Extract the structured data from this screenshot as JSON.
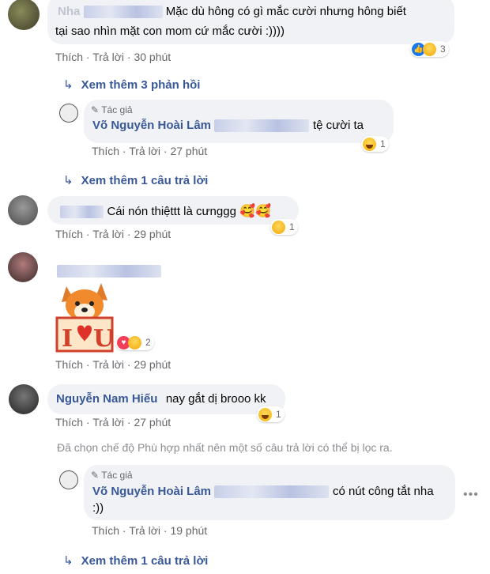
{
  "comments": [
    {
      "name_prefix": "Nha",
      "text": "Mặc dù hông có gì mắc cười nhưng hông biết tại sao nhìn mặt con mom cứ mắc cười :))))",
      "line1": "Mặc dù hông có gì mắc cười nhưng hông biết",
      "line2": "tại sao nhìn mặt con mom cứ mắc cười :))))",
      "like": "Thích",
      "reply": "Trả lời",
      "time": "30 phút",
      "reaction_count": "3",
      "more_replies": "Xem thêm 3 phản hồi"
    },
    {
      "author_label": "Tác giả",
      "name": "Võ Nguyễn Hoài Lâm",
      "text": "tệ cười ta",
      "like": "Thích",
      "reply": "Trả lời",
      "time": "27 phút",
      "reaction_count": "1",
      "more_replies": "Xem thêm 1 câu trả lời"
    },
    {
      "text": "Cái nón thiệttt là cưnggg",
      "like": "Thích",
      "reply": "Trả lời",
      "time": "29 phút",
      "reaction_count": "1"
    },
    {
      "sticker_text": "I U",
      "like": "Thích",
      "reply": "Trả lời",
      "time": "29 phút",
      "reaction_count": "2"
    },
    {
      "name": "Nguyễn Nam Hiếu",
      "text": "nay gắt dị brooo kk",
      "like": "Thích",
      "reply": "Trả lời",
      "time": "27 phút",
      "reaction_count": "1"
    },
    {
      "notice": "Đã chọn chế độ Phù hợp nhất nên một số câu trả lời có thể bị lọc ra."
    },
    {
      "author_label": "Tác giả",
      "name": "Võ Nguyễn Hoài Lâm",
      "text_line1": "có nút công tắt nha",
      "text_line2": ":))",
      "like": "Thích",
      "reply": "Trả lời",
      "time": "19 phút",
      "more_replies": "Xem thêm 1 câu trả lời"
    }
  ],
  "separator": "·",
  "options_icon": "more-horizontal-icon",
  "colors": {
    "name": "#385898",
    "bubble": "#f0f2f5",
    "meta": "#65676b"
  }
}
